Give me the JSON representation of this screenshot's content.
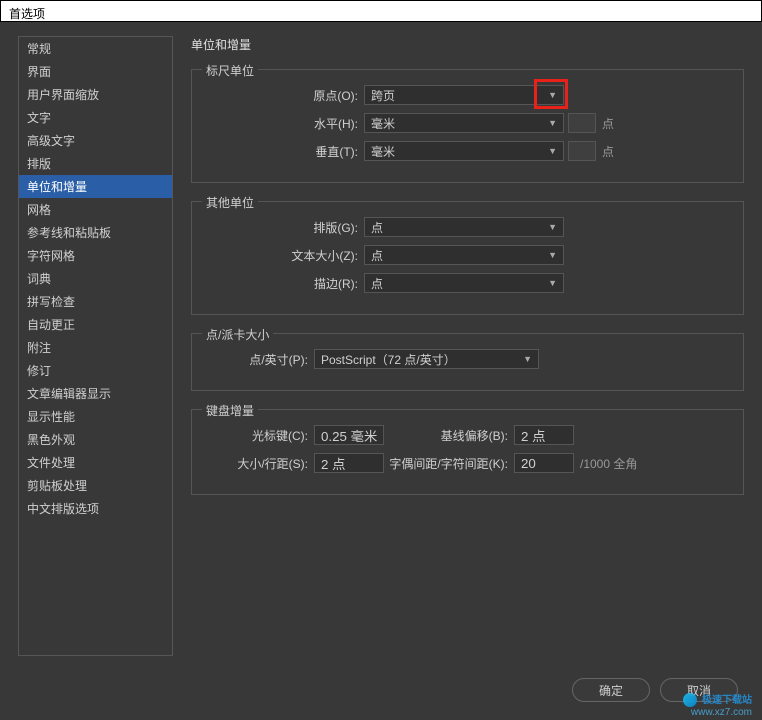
{
  "window": {
    "title": "首选项"
  },
  "sidebar": {
    "items": [
      "常规",
      "界面",
      "用户界面缩放",
      "文字",
      "高级文字",
      "排版",
      "单位和增量",
      "网格",
      "参考线和粘贴板",
      "字符网格",
      "词典",
      "拼写检查",
      "自动更正",
      "附注",
      "修订",
      "文章编辑器显示",
      "显示性能",
      "黑色外观",
      "文件处理",
      "剪贴板处理",
      "中文排版选项"
    ],
    "selectedIndex": 6
  },
  "panel": {
    "title": "单位和增量",
    "ruler": {
      "legend": "标尺单位",
      "origin_label": "原点(O):",
      "origin_value": "跨页",
      "h_label": "水平(H):",
      "h_value": "毫米",
      "h_unit": "点",
      "v_label": "垂直(T):",
      "v_value": "毫米",
      "v_unit": "点"
    },
    "other": {
      "legend": "其他单位",
      "layout_label": "排版(G):",
      "layout_value": "点",
      "textsize_label": "文本大小(Z):",
      "textsize_value": "点",
      "stroke_label": "描边(R):",
      "stroke_value": "点"
    },
    "pica": {
      "legend": "点/派卡大小",
      "label": "点/英寸(P):",
      "value": "PostScript（72 点/英寸）"
    },
    "keyboard": {
      "legend": "键盘增量",
      "cursor_label": "光标键(C):",
      "cursor_value": "0.25 毫米",
      "baseline_label": "基线偏移(B):",
      "baseline_value": "2 点",
      "size_label": "大小/行距(S):",
      "size_value": "2 点",
      "kern_label": "字偶间距/字符间距(K):",
      "kern_value": "20",
      "kern_suffix": "/1000 全角"
    }
  },
  "footer": {
    "ok": "确定",
    "cancel": "取消"
  },
  "watermark": {
    "name": "极速下载站",
    "url": "www.xz7.com"
  }
}
